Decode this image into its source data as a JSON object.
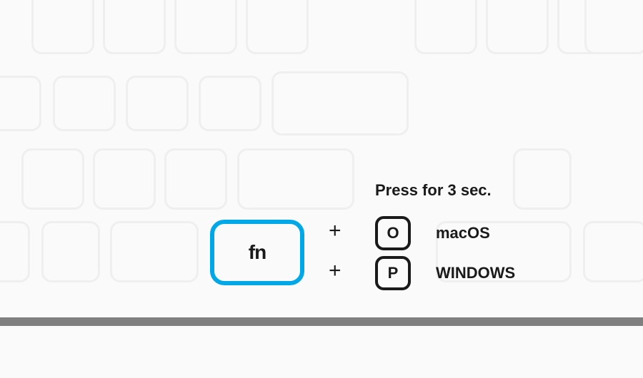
{
  "instruction": "Press for 3 sec.",
  "main_key": {
    "label": "fn"
  },
  "combos": [
    {
      "plus": "+",
      "key": "O",
      "os": "macOS"
    },
    {
      "plus": "+",
      "key": "P",
      "os": "WINDOWS"
    }
  ],
  "colors": {
    "highlight": "#00a8e8"
  }
}
